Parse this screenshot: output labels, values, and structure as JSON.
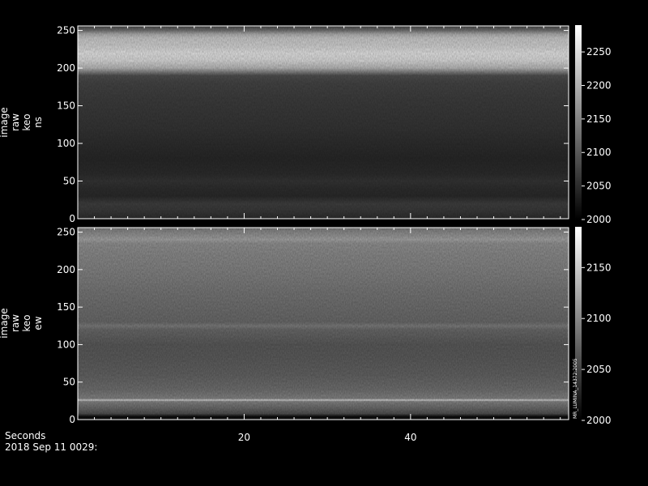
{
  "chart_data": [
    {
      "type": "heatmap",
      "ylabel": [
        "image",
        "raw",
        "keo",
        "ns"
      ],
      "xlim": [
        0,
        59
      ],
      "ylim": [
        0,
        256
      ],
      "yticks": [
        "0",
        "50",
        "100",
        "150",
        "200",
        "250"
      ],
      "ytick_values": [
        0,
        50,
        100,
        150,
        200,
        250
      ],
      "colorbar": {
        "range": [
          2000,
          2290
        ],
        "ticks": [
          "2000",
          "2050",
          "2100",
          "2150",
          "2200",
          "2250"
        ],
        "tick_values": [
          2000,
          2050,
          2100,
          2150,
          2200,
          2250
        ]
      },
      "row_profile": [
        [
          0,
          2050
        ],
        [
          10,
          2065
        ],
        [
          20,
          2072
        ],
        [
          30,
          2048
        ],
        [
          40,
          2052
        ],
        [
          50,
          2060
        ],
        [
          60,
          2050
        ],
        [
          80,
          2045
        ],
        [
          100,
          2052
        ],
        [
          120,
          2060
        ],
        [
          140,
          2065
        ],
        [
          160,
          2070
        ],
        [
          180,
          2078
        ],
        [
          190,
          2090
        ],
        [
          195,
          2150
        ],
        [
          200,
          2210
        ],
        [
          210,
          2250
        ],
        [
          220,
          2260
        ],
        [
          230,
          2240
        ],
        [
          240,
          2230
        ],
        [
          245,
          2200
        ],
        [
          250,
          2130
        ],
        [
          256,
          2080
        ]
      ],
      "colormap": "grayscale"
    },
    {
      "type": "heatmap",
      "ylabel": [
        "image",
        "raw",
        "keo",
        "ew"
      ],
      "xlim": [
        0,
        59
      ],
      "ylim": [
        0,
        256
      ],
      "yticks": [
        "0",
        "50",
        "100",
        "150",
        "200",
        "250"
      ],
      "ytick_values": [
        0,
        50,
        100,
        150,
        200,
        250
      ],
      "colorbar": {
        "range": [
          2000,
          2190
        ],
        "ticks": [
          "2000",
          "2050",
          "2100",
          "2150"
        ],
        "tick_values": [
          2000,
          2050,
          2100,
          2150
        ]
      },
      "colorbar_annotation": "MR_LUMINA_14372:2005",
      "row_profile": [
        [
          0,
          2010
        ],
        [
          4,
          2010
        ],
        [
          8,
          2060
        ],
        [
          15,
          2080
        ],
        [
          24,
          2100
        ],
        [
          26,
          2160
        ],
        [
          28,
          2100
        ],
        [
          40,
          2085
        ],
        [
          60,
          2075
        ],
        [
          80,
          2070
        ],
        [
          100,
          2068
        ],
        [
          120,
          2080
        ],
        [
          125,
          2095
        ],
        [
          130,
          2080
        ],
        [
          150,
          2085
        ],
        [
          170,
          2090
        ],
        [
          200,
          2100
        ],
        [
          220,
          2105
        ],
        [
          235,
          2110
        ],
        [
          240,
          2125
        ],
        [
          245,
          2115
        ],
        [
          256,
          2095
        ]
      ],
      "colormap": "grayscale"
    }
  ],
  "x_axis": {
    "label": "Seconds",
    "ticks": [
      "20",
      "40"
    ],
    "tick_values": [
      20,
      40
    ]
  },
  "footer": {
    "xlabel": "Seconds",
    "date": "2018 Sep 11 0029:"
  }
}
